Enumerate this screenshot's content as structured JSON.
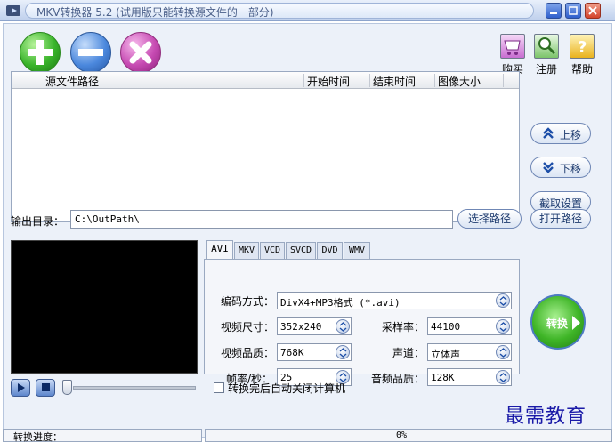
{
  "window": {
    "title": "MKV转换器 5.2 (试用版只能转换源文件的一部分)",
    "icon": "app-icon"
  },
  "toolbar": {
    "add_label": "添加",
    "delete_label": "删除",
    "clear_label": "清空",
    "buy_label": "购买",
    "register_label": "注册",
    "help_label": "帮助"
  },
  "filelist": {
    "columns": [
      "源文件路径",
      "开始时间",
      "结束时间",
      "图像大小"
    ],
    "rows": []
  },
  "side": {
    "up_label": "上移",
    "down_label": "下移",
    "capture_label": "截取设置",
    "open_path_label": "打开路径"
  },
  "output": {
    "label": "输出目录：",
    "value": "C:\\OutPath\\",
    "choose_label": "选择路径"
  },
  "tabs": [
    "AVI",
    "MKV",
    "VCD",
    "SVCD",
    "DVD",
    "WMV"
  ],
  "active_tab": "AVI",
  "settings": {
    "encoding_label": "编码方式：",
    "encoding_value": "DivX4+MP3格式 (*.avi)",
    "size_label": "视频尺寸：",
    "size_value": "352x240",
    "quality_label": "视频品质：",
    "quality_value": "768K",
    "fps_label": "帧率/秒：",
    "fps_value": "25",
    "samplerate_label": "采样率：",
    "samplerate_value": "44100",
    "channel_label": "声道：",
    "channel_value": "立体声",
    "audio_quality_label": "音频品质：",
    "audio_quality_value": "128K"
  },
  "convert_label": "转换",
  "auto_shutdown_label": "转换完后自动关闭计算机",
  "status": {
    "progress_label": "转换进度：",
    "progress_percent": "0%",
    "progress_value": 0
  },
  "watermark": "最需教育",
  "colors": {
    "title_text": "#4a5f89",
    "panel_bg": "#ecf1f9",
    "watermark": "#1a1aa8"
  }
}
